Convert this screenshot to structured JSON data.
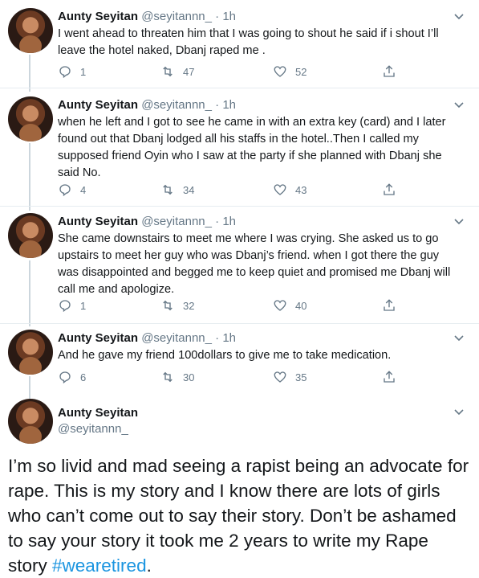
{
  "tweets": [
    {
      "name": "Aunty Seyitan",
      "handle": "@seyitannn_",
      "time": "· 1h",
      "text": "I went ahead to  threaten him that I was going to shout he said if i shout I’ll leave the hotel naked, Dbanj raped me .",
      "replies": "1",
      "retweets": "47",
      "likes": "52"
    },
    {
      "name": "Aunty Seyitan",
      "handle": "@seyitannn_",
      "time": "· 1h",
      "text": "when he left and I got to see he came in with an extra key (card) and I later found out that Dbanj lodged all his staffs in the hotel..Then I called my supposed friend Oyin who I saw at the party if she planned with Dbanj she said No.",
      "replies": "4",
      "retweets": "34",
      "likes": "43"
    },
    {
      "name": "Aunty Seyitan",
      "handle": "@seyitannn_",
      "time": "· 1h",
      "text": "She came downstairs to meet me where I was crying. She asked us to go upstairs to meet her guy who was Dbanj’s friend.  when I got there the guy was disappointed and begged me to keep quiet and promised me Dbanj will call me and apologize.",
      "replies": "1",
      "retweets": "32",
      "likes": "40"
    },
    {
      "name": "Aunty Seyitan",
      "handle": "@seyitannn_",
      "time": "· 1h",
      "text": "And he gave my friend 100dollars to give me to take medication.",
      "replies": "6",
      "retweets": "30",
      "likes": "35"
    }
  ],
  "main_tweet": {
    "name": "Aunty Seyitan",
    "handle": "@seyitannn_",
    "text": "I’m so livid and mad seeing a rapist being an advocate for rape. This is my story and I know there are lots of girls who can’t come out to say their story. Don’t be ashamed to say your story it took me 2 years to write my Rape story ",
    "hashtag": "#wearetired",
    "trailing": "."
  },
  "colors": {
    "hashtag": "#1b95e0",
    "secondary_text": "#657786",
    "thread_line": "#ccd6dd"
  },
  "icons": [
    "reply-icon",
    "retweet-icon",
    "like-icon",
    "share-icon",
    "chevron-down-icon"
  ]
}
